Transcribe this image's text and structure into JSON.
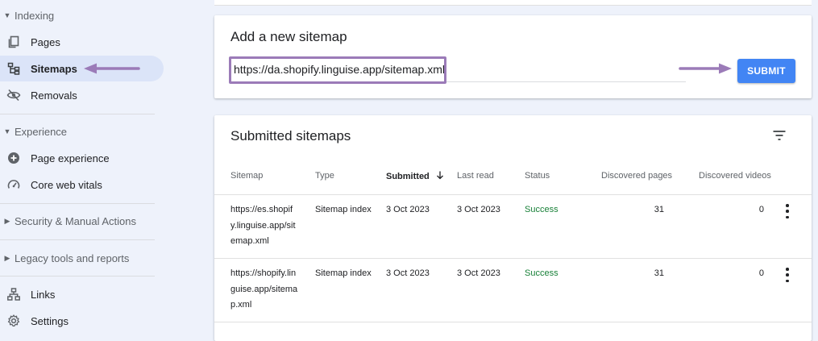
{
  "sidebar": {
    "sections": {
      "indexing": "Indexing",
      "experience": "Experience",
      "security": "Security & Manual Actions",
      "legacy": "Legacy tools and reports"
    },
    "items": {
      "pages": "Pages",
      "sitemaps": "Sitemaps",
      "removals": "Removals",
      "page_experience": "Page experience",
      "core_web_vitals": "Core web vitals",
      "links": "Links",
      "settings": "Settings"
    }
  },
  "add_sitemap": {
    "title": "Add a new sitemap",
    "input_value": "https://da.shopify.linguise.app/sitemap.xml",
    "submit_label": "SUBMIT"
  },
  "submitted": {
    "title": "Submitted sitemaps",
    "columns": [
      "Sitemap",
      "Type",
      "Submitted",
      "Last read",
      "Status",
      "Discovered pages",
      "Discovered videos"
    ],
    "rows": [
      {
        "sitemap_lines": [
          "https://es.shopif",
          "y.linguise.app/sit",
          "emap.xml"
        ],
        "type": "Sitemap index",
        "submitted": "3 Oct 2023",
        "last_read": "3 Oct 2023",
        "status": "Success",
        "pages": "31",
        "videos": "0"
      },
      {
        "sitemap_lines": [
          "https://shopify.lin",
          "guise.app/sitema",
          "p.xml"
        ],
        "type": "Sitemap index",
        "submitted": "3 Oct 2023",
        "last_read": "3 Oct 2023",
        "status": "Success",
        "pages": "31",
        "videos": "0"
      }
    ]
  },
  "colors": {
    "accent": "#4285f4",
    "success": "#188038",
    "annotation_arrow": "#9b7bb8",
    "active_nav": "#dbe4f8"
  }
}
